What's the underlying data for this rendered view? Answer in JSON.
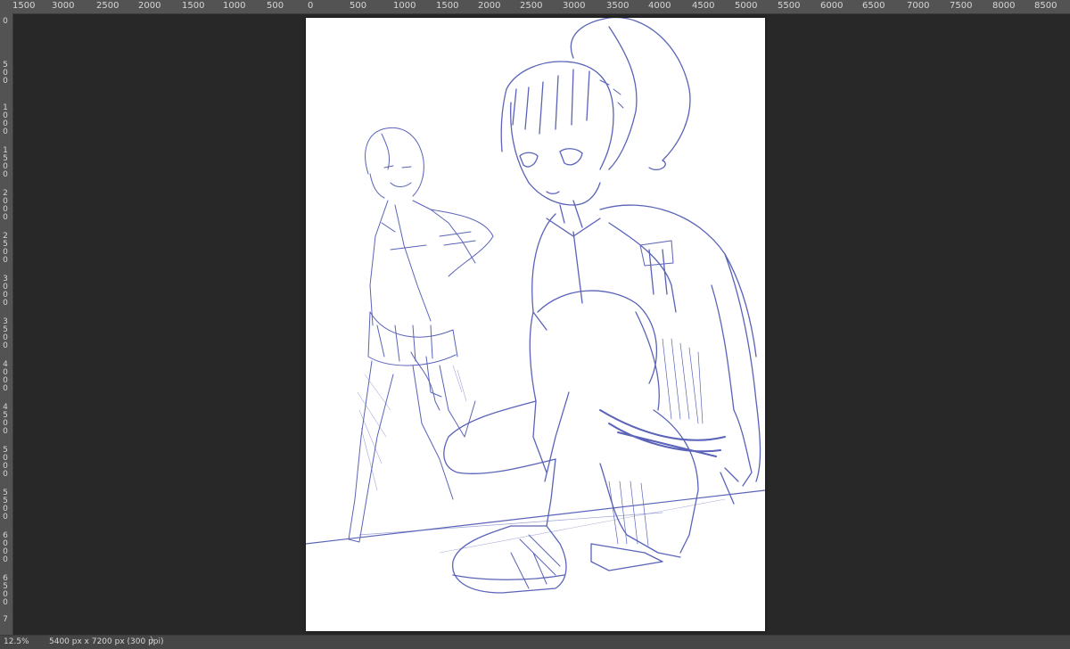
{
  "rulers": {
    "top": [
      "1500",
      "3000",
      "2500",
      "2000",
      "1500",
      "1000",
      "500",
      "0",
      "500",
      "1000",
      "1500",
      "2000",
      "2500",
      "3000",
      "3500",
      "4000",
      "4500",
      "5000",
      "5500",
      "6000",
      "6500",
      "7000",
      "7500",
      "8000",
      "8500"
    ],
    "left": [
      "0",
      "500",
      "1000",
      "1500",
      "2000",
      "2500",
      "3000",
      "3500",
      "4000",
      "4500",
      "5000",
      "5500",
      "6000",
      "6500",
      "7"
    ]
  },
  "document": {
    "artwork": "sketch-artwork",
    "stroke_color": "#5a63b8"
  },
  "status_bar": {
    "zoom": "12.5%",
    "doc_info": "5400 px x 7200 px (300 ppi)",
    "arrow": "〉"
  },
  "colors": {
    "background": "#282828",
    "ruler": "#535353",
    "status": "#464646"
  }
}
